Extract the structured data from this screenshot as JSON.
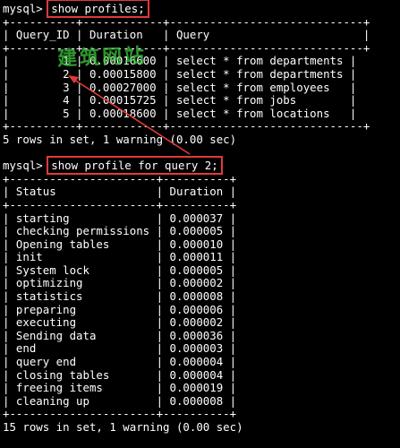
{
  "session1": {
    "prompt": "mysql>",
    "command": "show profiles;",
    "border": "+----------+------------+-----------------------------+",
    "header": "| Query_ID | Duration   | Query                       |",
    "rows": [
      "|        1 | 0.00016600 | select * from departments |",
      "|        2 | 0.00015800 | select * from departments |",
      "|        3 | 0.00027000 | select * from employees   |",
      "|        4 | 0.00015725 | select * from jobs        |",
      "|        5 | 0.00018600 | select * from locations   |"
    ],
    "result": "5 rows in set, 1 warning (0.00 sec)"
  },
  "session2": {
    "prompt": "mysql>",
    "command": "show profile for query 2;",
    "border": "+----------------------+----------+",
    "header": "| Status               | Duration |",
    "rows": [
      "| starting             | 0.000037 |",
      "| checking permissions | 0.000005 |",
      "| Opening tables       | 0.000010 |",
      "| init                 | 0.000011 |",
      "| System lock          | 0.000005 |",
      "| optimizing           | 0.000002 |",
      "| statistics           | 0.000008 |",
      "| preparing            | 0.000006 |",
      "| executing            | 0.000002 |",
      "| Sending data         | 0.000036 |",
      "| end                  | 0.000003 |",
      "| query end            | 0.000004 |",
      "| closing tables       | 0.000004 |",
      "| freeing items        | 0.000019 |",
      "| cleaning up          | 0.000008 |"
    ],
    "result": "15 rows in set, 1 warning (0.00 sec)"
  },
  "watermark": "建筑网站",
  "colors": {
    "background": "#000000",
    "text": "#ffffff",
    "highlight": "#e03a3a",
    "watermark": "#3cc83c"
  }
}
